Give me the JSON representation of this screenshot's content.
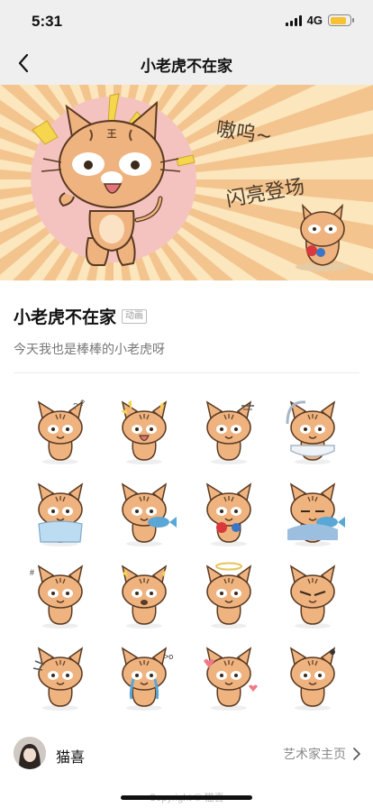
{
  "status": {
    "time": "5:31",
    "network": "4G",
    "battery_level": 0.85
  },
  "nav": {
    "title": "小老虎不在家",
    "back_icon": "chevron-left-icon"
  },
  "banner": {
    "shout_text": "嗷呜~",
    "tagline": "闪亮登场",
    "badge_char": "王"
  },
  "pack": {
    "title": "小老虎不在家",
    "tag": "动画",
    "description": "今天我也是棒棒的小老虎呀"
  },
  "stickers": [
    {
      "variant": "puzzled"
    },
    {
      "variant": "excited"
    },
    {
      "variant": "chat"
    },
    {
      "variant": "bath"
    },
    {
      "variant": "blanket"
    },
    {
      "variant": "fish"
    },
    {
      "variant": "flower"
    },
    {
      "variant": "sleep-fish"
    },
    {
      "variant": "angry"
    },
    {
      "variant": "shock"
    },
    {
      "variant": "halo"
    },
    {
      "variant": "grumpy"
    },
    {
      "variant": "sweat"
    },
    {
      "variant": "cry"
    },
    {
      "variant": "love"
    },
    {
      "variant": "frown"
    }
  ],
  "artist": {
    "name": "猫喜",
    "link_label": "艺术家主页"
  },
  "footer": {
    "copyright": "Copyright © 猫喜"
  }
}
